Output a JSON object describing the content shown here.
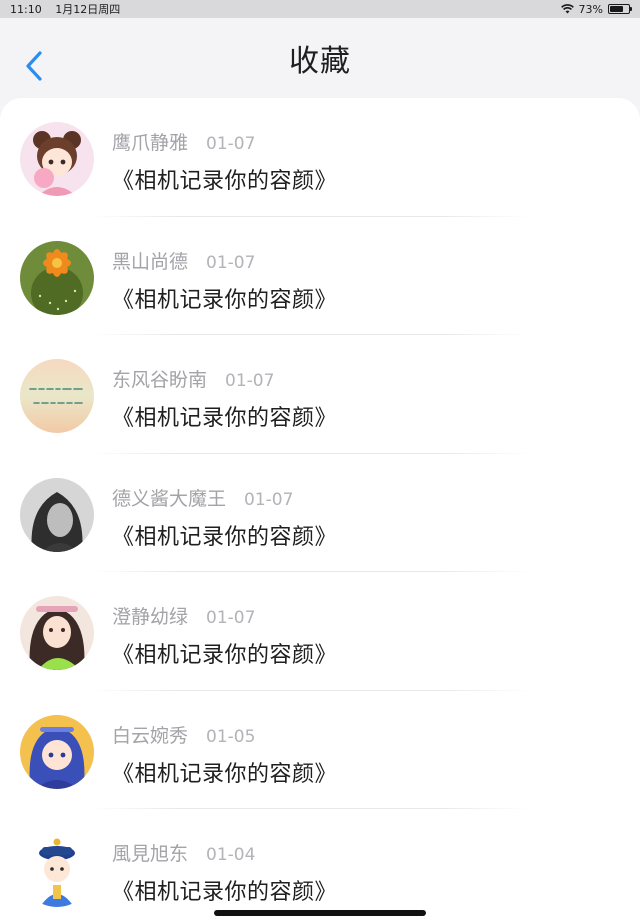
{
  "status_bar": {
    "time": "11:10",
    "date": "1月12日周四",
    "battery_text": "73%",
    "battery_level": 0.73
  },
  "header": {
    "title": "收藏",
    "back_icon": "chevron-left-icon",
    "accent_color": "#2b8df0"
  },
  "favorites": [
    {
      "author": "鹰爪静雅",
      "date": "01-07",
      "title": "《相机记录你的容颜》",
      "avatar": "anime-girl-pink"
    },
    {
      "author": "黑山尚德",
      "date": "01-07",
      "title": "《相机记录你的容颜》",
      "avatar": "cactus-flower"
    },
    {
      "author": "东风谷盼南",
      "date": "01-07",
      "title": "《相机记录你的容颜》",
      "avatar": "calligraphy-text"
    },
    {
      "author": "德义酱大魔王",
      "date": "01-07",
      "title": "《相机记录你的容颜》",
      "avatar": "monochrome-portrait"
    },
    {
      "author": "澄静幼绿",
      "date": "01-07",
      "title": "《相机记录你的容颜》",
      "avatar": "girl-green-shirt"
    },
    {
      "author": "白云婉秀",
      "date": "01-05",
      "title": "《相机记录你的容颜》",
      "avatar": "blue-hair-character"
    },
    {
      "author": "風見旭东",
      "date": "01-04",
      "title": "《相机记录你的容颜》",
      "avatar": "qing-official-cartoon"
    }
  ]
}
